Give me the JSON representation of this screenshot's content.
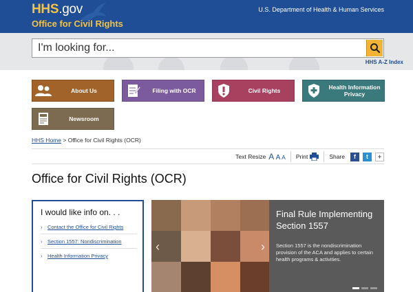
{
  "header": {
    "logo_main": "HHS",
    "logo_suffix": ".gov",
    "office": "Office for Civil Rights",
    "department": "U.S. Department of Health & Human Services"
  },
  "search": {
    "placeholder": "I'm looking for...",
    "az_index": "HHS A-Z Index"
  },
  "tiles": [
    {
      "label": "About Us",
      "icon": "people-icon",
      "color": "#a1632a"
    },
    {
      "label": "Filing with OCR",
      "icon": "form-icon",
      "color": "#7b5a9d"
    },
    {
      "label": "Civil Rights",
      "icon": "shield-icon",
      "color": "#a8405f"
    },
    {
      "label": "Health Information Privacy",
      "icon": "shield-cross-icon",
      "color": "#3a7a7c"
    },
    {
      "label": "Newsroom",
      "icon": "newspaper-icon",
      "color": "#7c6b51"
    }
  ],
  "breadcrumb": {
    "home": "HHS Home",
    "separator": ">",
    "current": "Office for Civil Rights (OCR)"
  },
  "tools": {
    "text_resize": "Text Resize",
    "aa": "A A A",
    "print": "Print",
    "share": "Share",
    "plus": "+"
  },
  "page_title": "Office for Civil Rights (OCR)",
  "info_box": {
    "title": "I would like info on. . .",
    "links": [
      "Contact the Office for Civil Rights",
      "Section 1557: Nondiscrimination",
      "Health Information Privacy"
    ]
  },
  "carousel": {
    "title": "Final Rule Implementing Section 1557",
    "body": "Section 1557 is the nondiscrimination provision of the ACA and applies to certain health programs & activities.",
    "slides": 3,
    "active_slide": 1
  }
}
